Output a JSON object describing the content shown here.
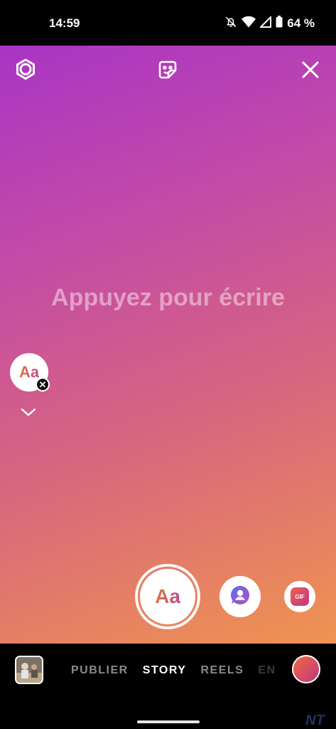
{
  "status_bar": {
    "time": "14:59",
    "battery": "64 %"
  },
  "canvas": {
    "placeholder": "Appuyez pour écrire",
    "gradient": [
      "#a934c4",
      "#c24aa8",
      "#d8667e",
      "#ef9451"
    ],
    "font_style_label": "Aa"
  },
  "toolbar": {
    "icons": [
      "settings-icon",
      "sticker-icon",
      "close-icon"
    ]
  },
  "modes": {
    "text_label": "Aa",
    "gif_label": "GIF"
  },
  "bottom_nav": {
    "tabs": [
      "PUBLIER",
      "STORY",
      "REELS",
      "EN"
    ],
    "active_tab": "STORY"
  },
  "watermark": "NT"
}
